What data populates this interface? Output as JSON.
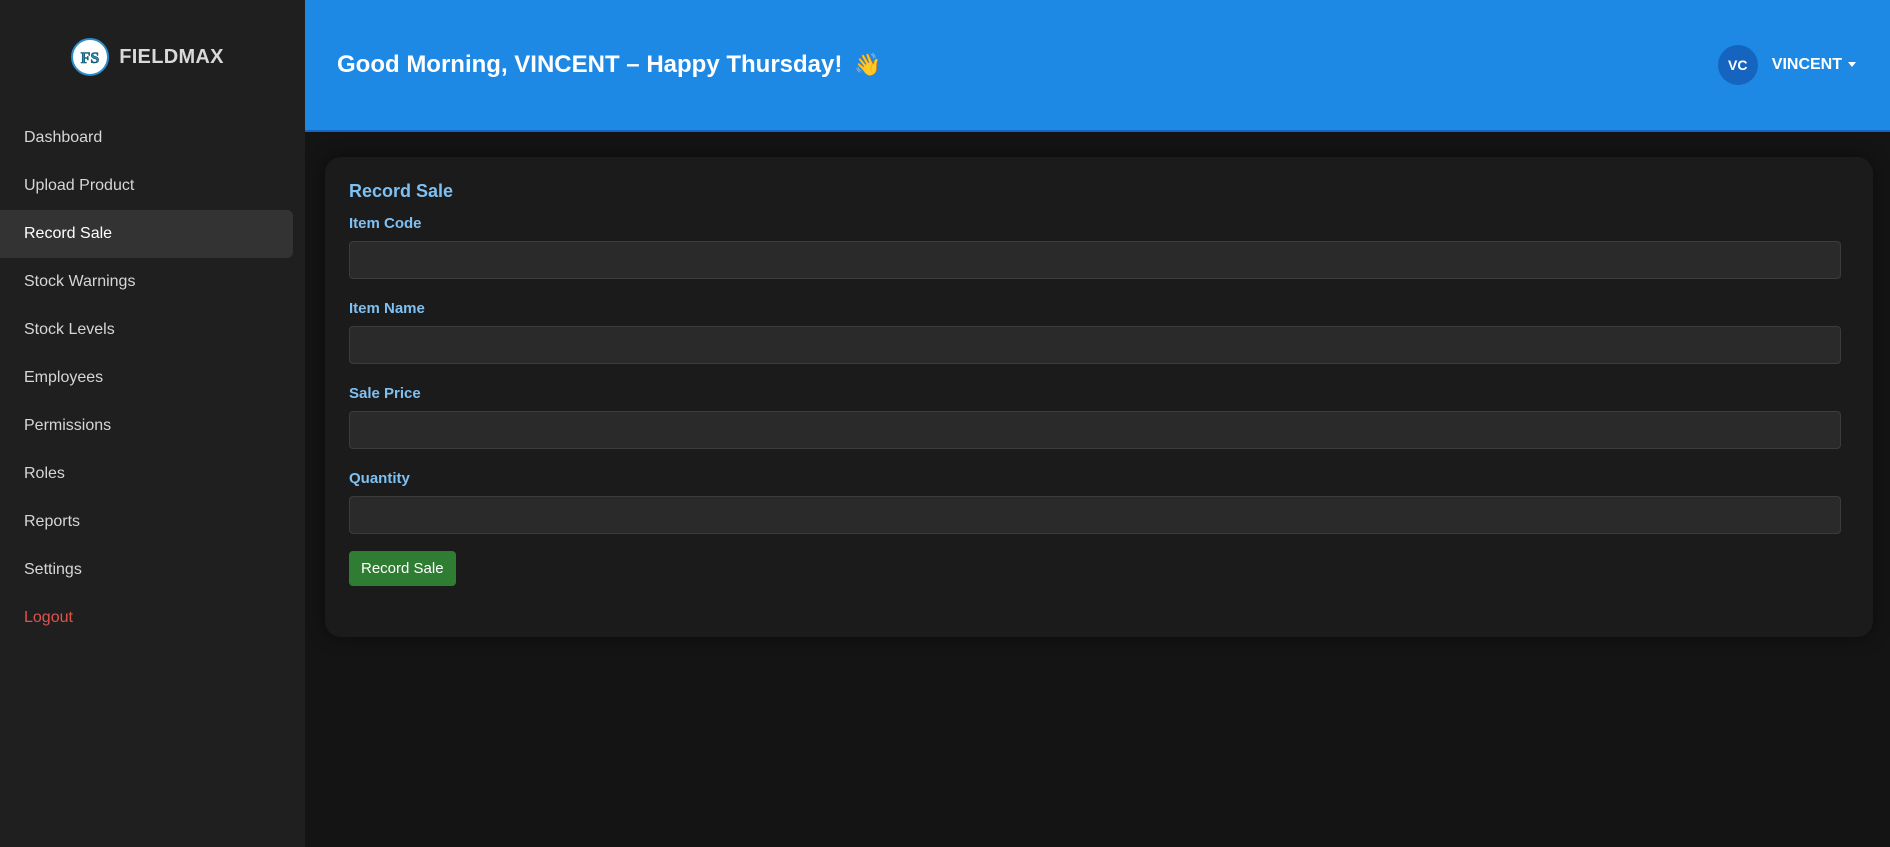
{
  "brand": {
    "name": "FIELDMAX",
    "logo_text": "FS"
  },
  "sidebar": {
    "items": [
      {
        "label": "Dashboard"
      },
      {
        "label": "Upload Product"
      },
      {
        "label": "Record Sale"
      },
      {
        "label": "Stock Warnings"
      },
      {
        "label": "Stock Levels"
      },
      {
        "label": "Employees"
      },
      {
        "label": "Permissions"
      },
      {
        "label": "Roles"
      },
      {
        "label": "Reports"
      },
      {
        "label": "Settings"
      },
      {
        "label": "Logout"
      }
    ],
    "active_index": 2
  },
  "header": {
    "greeting": "Good Morning, VINCENT – Happy Thursday!",
    "wave_emoji": "👋",
    "user_initials": "VC",
    "username": "VINCENT"
  },
  "form": {
    "title": "Record Sale",
    "fields": [
      {
        "label": "Item Code",
        "value": ""
      },
      {
        "label": "Item Name",
        "value": ""
      },
      {
        "label": "Sale Price",
        "value": ""
      },
      {
        "label": "Quantity",
        "value": ""
      }
    ],
    "submit_label": "Record Sale"
  },
  "colors": {
    "header_bg": "#1e88e5",
    "sidebar_bg": "#1f1f1f",
    "page_bg": "#141414",
    "label_blue": "#7fc0f2",
    "submit_green": "#2e7d32",
    "logout_red": "#e0534f"
  }
}
